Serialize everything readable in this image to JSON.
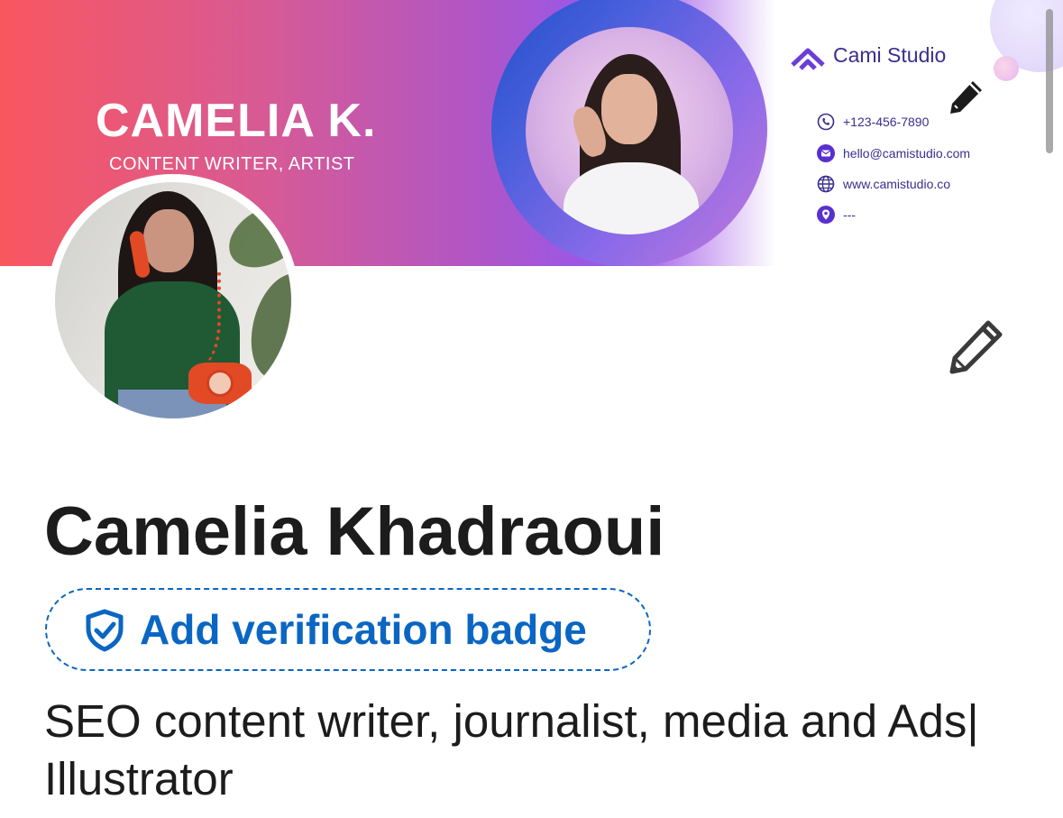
{
  "banner": {
    "name": "CAMELIA K.",
    "role": "CONTENT WRITER, ARTIST",
    "studio_name": "Cami Studio",
    "contacts": [
      {
        "icon": "phone-icon",
        "text": "+123-456-7890"
      },
      {
        "icon": "mail-icon",
        "text": "hello@camistudio.com"
      },
      {
        "icon": "globe-icon",
        "text": "www.camistudio.co"
      },
      {
        "icon": "location-pin-icon",
        "text": "---"
      }
    ],
    "edit_icon": "pencil-icon"
  },
  "profile": {
    "full_name": "Camelia Khadraoui",
    "verification_badge_label": "Add verification badge",
    "verification_icon": "shield-check-icon",
    "headline": "SEO content writer, journalist, media and Ads| Illustrator",
    "edit_icon": "pencil-icon"
  },
  "colors": {
    "link_blue": "#0a66c2",
    "banner_start": "#f9575f",
    "banner_mid": "#b056c6",
    "studio_purple": "#3a2e8f",
    "text_primary": "#1c1c1c"
  }
}
